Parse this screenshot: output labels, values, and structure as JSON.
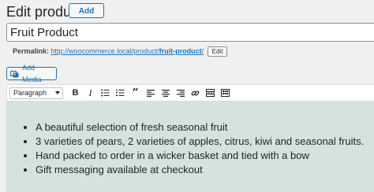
{
  "header": {
    "title": "Edit product",
    "add_new_label": "Add New"
  },
  "title_field": {
    "value": "Fruit Product"
  },
  "permalink": {
    "label": "Permalink:",
    "url_prefix": "http://woocommerce.local/product/",
    "url_slug": "fruit-product",
    "url_suffix": "/",
    "edit_label": "Edit"
  },
  "media": {
    "add_media_label": "Add Media"
  },
  "toolbar": {
    "format_value": "Paragraph",
    "buttons": [
      "bold-icon",
      "italic-icon",
      "bulleted-list-icon",
      "numbered-list-icon",
      "blockquote-icon",
      "align-left-icon",
      "align-center-icon",
      "align-right-icon",
      "link-icon",
      "read-more-icon",
      "toolbar-toggle-icon"
    ]
  },
  "editor": {
    "background": "#d5e3dd",
    "items": [
      "A beautiful selection of fresh seasonal fruit",
      "3 varieties of pears, 2 varieties of apples, citrus, kiwi and seasonal fruits.",
      "Hand packed to order in a wicker basket and tied with a bow",
      "Gift messaging available at checkout"
    ]
  },
  "colors": {
    "accent": "#2271b1",
    "page_bg": "#f0f0f1"
  }
}
